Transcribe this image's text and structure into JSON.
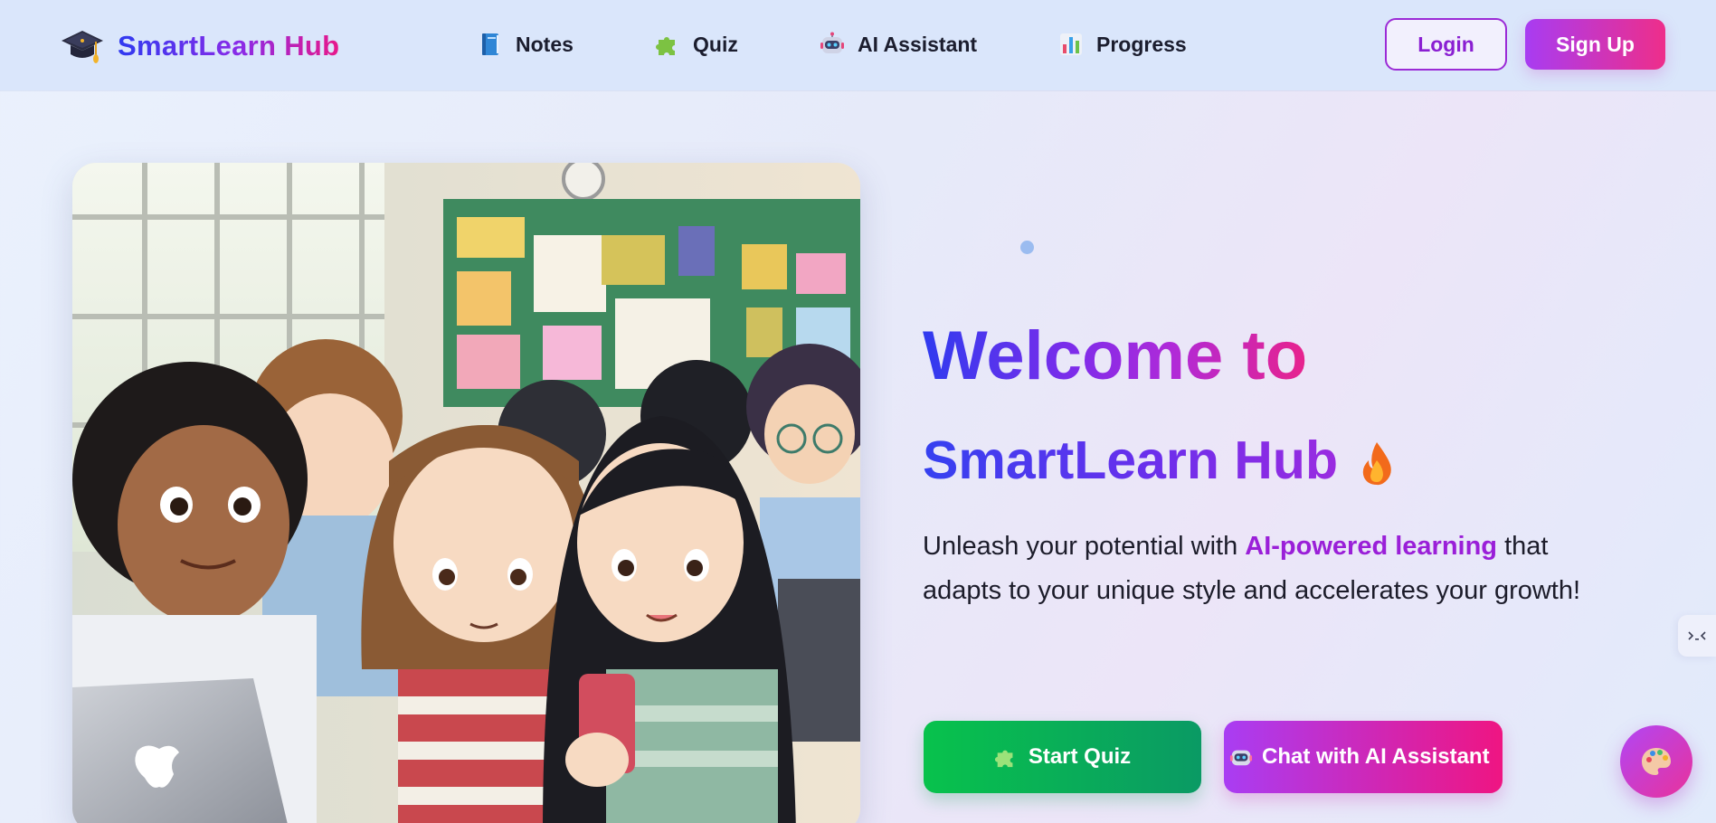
{
  "brand": {
    "name": "SmartLearn Hub",
    "icon": "graduation-cap-icon"
  },
  "nav": {
    "items": [
      {
        "label": "Notes",
        "icon": "blue-book-icon"
      },
      {
        "label": "Quiz",
        "icon": "puzzle-piece-icon"
      },
      {
        "label": "AI Assistant",
        "icon": "robot-icon"
      },
      {
        "label": "Progress",
        "icon": "bar-chart-icon"
      }
    ],
    "login_label": "Login",
    "signup_label": "Sign Up"
  },
  "hero": {
    "title_line1": "Welcome to",
    "title_line2": "SmartLearn Hub",
    "title_icon": "fire-icon",
    "description_part1": "Unleash your potential with ",
    "description_highlight": "AI-powered learning",
    "description_part2": " that adapts to your unique style and accelerates your growth!",
    "image_subject": "anime-style students in a classroom illustration",
    "primary_button": {
      "label": "Start Quiz",
      "icon": "puzzle-piece-icon"
    },
    "secondary_button": {
      "label": "Chat with AI Assistant",
      "icon": "robot-icon"
    }
  },
  "widgets": {
    "side_tab_icon": "collapse-arrows-icon",
    "fab_icon": "palette-icon"
  },
  "colors": {
    "brand_gradient_start": "#2f3af0",
    "brand_gradient_mid": "#8a2be8",
    "brand_gradient_end": "#e8188a",
    "quiz_button": "#08c24c",
    "chat_button_start": "#a93df3",
    "chat_button_end": "#ef1582",
    "highlight": "#9a1fd8",
    "nav_background": "#dae6fb"
  }
}
